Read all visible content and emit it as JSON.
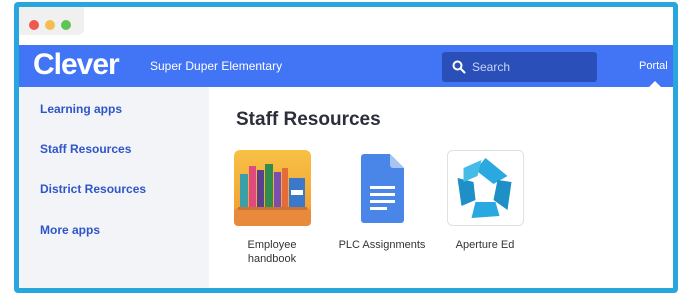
{
  "window": {
    "controls": [
      "close",
      "minimize",
      "maximize"
    ]
  },
  "navbar": {
    "logo": "Clever",
    "district": "Super Duper Elementary",
    "search": {
      "placeholder": "Search",
      "icon": "search-icon"
    },
    "portal_label": "Portal",
    "color": "#4274f6"
  },
  "sidebar": {
    "items": [
      {
        "label": "Learning apps"
      },
      {
        "label": "Staff Resources"
      },
      {
        "label": "District Resources"
      },
      {
        "label": "More apps"
      }
    ]
  },
  "main": {
    "title": "Staff Resources",
    "apps": [
      {
        "label": "Employee handbook",
        "icon": "bookshelf-icon"
      },
      {
        "label": "PLC Assignments",
        "icon": "google-docs-icon"
      },
      {
        "label": "Aperture Ed",
        "icon": "aperture-icon"
      }
    ]
  },
  "colors": {
    "frame_border": "#29a6dd",
    "link": "#2f55c9"
  }
}
